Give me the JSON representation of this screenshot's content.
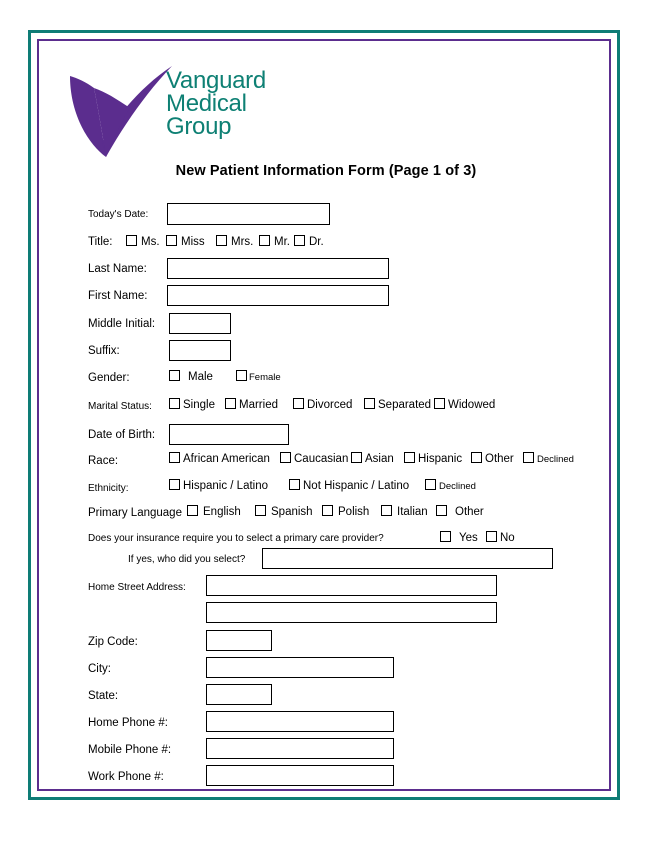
{
  "logo": {
    "line1": "Vanguard",
    "line2": "Medical",
    "line3": "Group",
    "checkmark_color": "#5B2D8E",
    "text_color": "#0E8074"
  },
  "frame": {
    "outer_color": "#0E7C76",
    "inner_color": "#5B2D8E"
  },
  "title": "New Patient Information Form (Page 1 of 3)",
  "fields": {
    "todays_date": {
      "label": "Today's  Date:",
      "value": ""
    },
    "title_label": "Title:",
    "title_options": [
      "Ms.",
      "Miss",
      "Mrs.",
      "Mr.",
      "Dr."
    ],
    "last_name": {
      "label": "Last Name:",
      "value": ""
    },
    "first_name": {
      "label": "First Name:",
      "value": ""
    },
    "middle_initial": {
      "label": "Middle Initial:",
      "value": ""
    },
    "suffix": {
      "label": "Suffix:",
      "value": ""
    },
    "gender_label": "Gender:",
    "gender_options": [
      "Male",
      "Female"
    ],
    "marital_label": "Marital  Status:",
    "marital_options": [
      "Single",
      "Married",
      "Divorced",
      "Separated",
      "Widowed"
    ],
    "date_of_birth": {
      "label": "Date of Birth:",
      "value": ""
    },
    "race_label": "Race:",
    "race_options": [
      "African American",
      "Caucasian",
      "Asian",
      "Hispanic",
      "Other",
      "Declined"
    ],
    "ethnicity_label": "Ethnicity:",
    "ethnicity_options": [
      "Hispanic / Latino",
      "Not Hispanic / Latino",
      "Declined"
    ],
    "language_label": "Primary Language",
    "language_options": [
      "English",
      "Spanish",
      "Polish",
      "Italian",
      "Other"
    ],
    "insurance_question": "Does  your  insurance  require  you  to select  a primary  care  provider?",
    "insurance_options": [
      "Yes",
      "No"
    ],
    "pcp_question": "If yes,  who  did  you  select?",
    "pcp_value": "",
    "home_street_address": {
      "label": "Home  Street  Address:",
      "value": "",
      "value2": ""
    },
    "zip_code": {
      "label": "Zip Code:",
      "value": ""
    },
    "city": {
      "label": "City:",
      "value": ""
    },
    "state": {
      "label": "State:",
      "value": ""
    },
    "home_phone": {
      "label": "Home Phone #:",
      "value": ""
    },
    "mobile_phone": {
      "label": "Mobile Phone #:",
      "value": ""
    },
    "work_phone": {
      "label": "Work Phone #:",
      "value": ""
    }
  }
}
